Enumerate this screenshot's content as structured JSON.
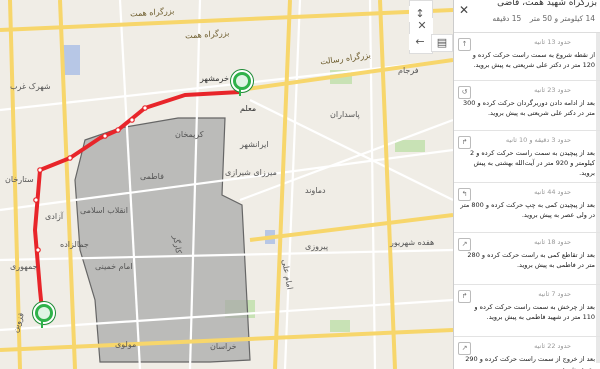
{
  "map": {
    "labels": [
      {
        "id": "l1",
        "text": "بزرگراه همت"
      },
      {
        "id": "l2",
        "text": "بزرگراه همت"
      },
      {
        "id": "l3",
        "text": "بزرگراه رسالت"
      },
      {
        "id": "l4",
        "text": "فرجام"
      },
      {
        "id": "l5",
        "text": "خرمشهر"
      },
      {
        "id": "l6",
        "text": "معلم"
      },
      {
        "id": "l7",
        "text": "انقلاب اسلامی"
      },
      {
        "id": "l8",
        "text": "آزادی"
      },
      {
        "id": "l9",
        "text": "امام خمینی"
      },
      {
        "id": "l10",
        "text": "دماوند"
      },
      {
        "id": "l11",
        "text": "پیروزی"
      },
      {
        "id": "l12",
        "text": "قزوین"
      },
      {
        "id": "l13",
        "text": "جمهوری"
      },
      {
        "id": "l14",
        "text": "مولوی"
      },
      {
        "id": "l15",
        "text": "خراسان"
      },
      {
        "id": "l16",
        "text": "شهرک غرب"
      },
      {
        "id": "l17",
        "text": "کارگر"
      },
      {
        "id": "l18",
        "text": "کریمخان"
      },
      {
        "id": "l19",
        "text": "ایرانشهر"
      },
      {
        "id": "l20",
        "text": "میرزای شیرازی"
      },
      {
        "id": "l21",
        "text": "ستارخان"
      },
      {
        "id": "l22",
        "text": "پاسداران"
      },
      {
        "id": "l23",
        "text": "امام علی"
      },
      {
        "id": "l24",
        "text": "هفده شهریور"
      },
      {
        "id": "l25",
        "text": "جمالزاده"
      },
      {
        "id": "l26",
        "text": "فاطمی"
      }
    ]
  },
  "toolbar": {
    "expand_icon": "↕",
    "close_icon": "✕",
    "back_icon": "←",
    "menu_icon": "▤"
  },
  "panel": {
    "title": "بزرگراه شهید همت، قاضی",
    "summary": "14 کیلومتر و 50 متر",
    "duration": "15 دقیقه",
    "close_icon": "✕",
    "steps": [
      {
        "time": "حدود 13 ثانیه",
        "text": "از نقطه شروع به سمت راست حرکت کرده و 120 متر در دکتر علی شریعتی به پیش بروید.",
        "icon": "↑"
      },
      {
        "time": "حدود 23 ثانیه",
        "text": "بعد از ادامه دادن دوربرگردان حرکت کرده و 300 متر در دکتر علی شریعتی به پیش بروید.",
        "icon": "↺"
      },
      {
        "time": "حدود 3 دقیقه و 10 ثانیه",
        "text": "بعد از پیچیدن به سمت راست حرکت کرده و 2 کیلومتر و 920 متر در آیت‌الله بهشتی به پیش بروید.",
        "icon": "↱"
      },
      {
        "time": "حدود 44 ثانیه",
        "text": "بعد از پیچیدن کمی به چپ حرکت کرده و 800 متر در ولی عصر به پیش بروید.",
        "icon": "↰"
      },
      {
        "time": "حدود 18 ثانیه",
        "text": "بعد از تقاطع کمی به راست حرکت کرده و 280 متر در فاطمی به پیش بروید.",
        "icon": "↗"
      },
      {
        "time": "حدود 7 ثانیه",
        "text": "بعد از چرخش به سمت راست حرکت کرده و 110 متر در شهید فاطمی به پیش بروید.",
        "icon": "↱"
      },
      {
        "time": "حدود 22 ثانیه",
        "text": "بعد از خروج از سمت راست حرکت کرده و 290 متر در شهید",
        "icon": "↗"
      }
    ]
  },
  "colors": {
    "route": "#e8252a",
    "district": "#a9a9a9",
    "marker": "#2fb24a",
    "highway": "#f7d66b"
  }
}
